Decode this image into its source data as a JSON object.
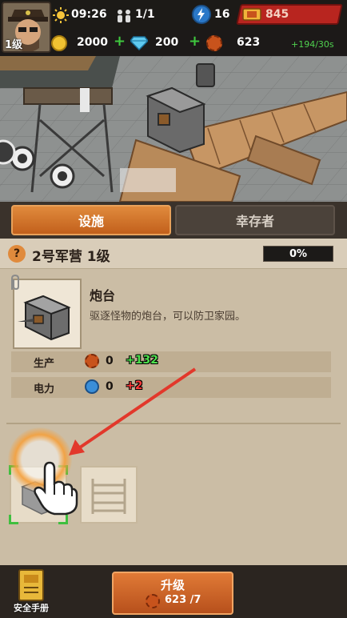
{
  "hud": {
    "time": "09:26",
    "population": "1/1",
    "energy": "16",
    "tickets": "845",
    "player_level": "1级",
    "coins": "2000",
    "gems": "200",
    "caps": "623",
    "caps_rate": "+194/30s",
    "plus_sign": "+"
  },
  "tabs": [
    {
      "label": "设施",
      "active": true
    },
    {
      "label": "幸存者",
      "active": false
    }
  ],
  "panel": {
    "help_symbol": "?",
    "title": "2号军营 1级",
    "progress": "0%"
  },
  "building": {
    "name": "炮台",
    "description": "驱逐怪物的炮台，可以防卫家园。"
  },
  "stats": [
    {
      "label": "生产",
      "value": "0",
      "delta": "+132",
      "delta_color": "#4de04d"
    },
    {
      "label": "电力",
      "value": "0",
      "delta": "+2",
      "delta_color": "#ff3b3b"
    }
  ],
  "bottom": {
    "manual_label": "安全手册",
    "upgrade_label": "升级",
    "upgrade_cost": "623 /7"
  },
  "colors": {
    "accent": "#d9772f",
    "highlight_green": "#3fbf3f",
    "arrow_red": "#e2382b"
  }
}
